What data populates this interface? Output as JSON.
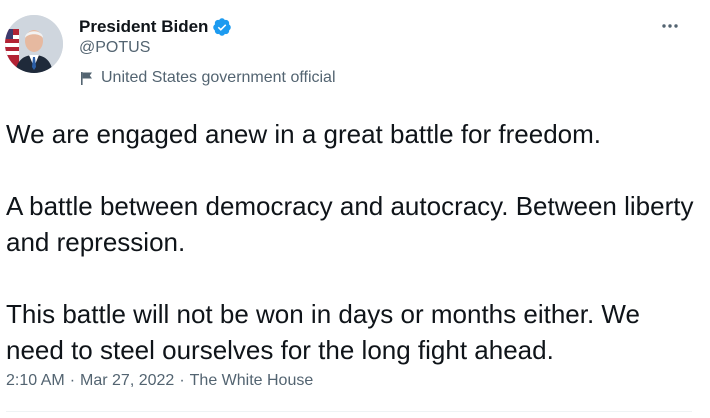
{
  "author": {
    "name": "President Biden",
    "handle": "@POTUS",
    "label": "United States government official",
    "verified": true,
    "verified_color": "#1d9bf0"
  },
  "tweet": {
    "paragraphs": [
      "We are engaged anew in a great battle for freedom.",
      "A battle between democracy and autocracy. Between liberty and repression.",
      "This battle will not be won in days or months either. We need to steel ourselves for the long fight ahead."
    ],
    "time": "2:10 AM",
    "separator": "·",
    "date": "Mar 27, 2022",
    "source": "The White House"
  },
  "icons": {
    "verified": "verified-badge-icon",
    "label": "flag-icon",
    "more": "more-options-icon"
  },
  "colors": {
    "text": "#0f1419",
    "secondary": "#536471",
    "accent": "#1d9bf0"
  }
}
